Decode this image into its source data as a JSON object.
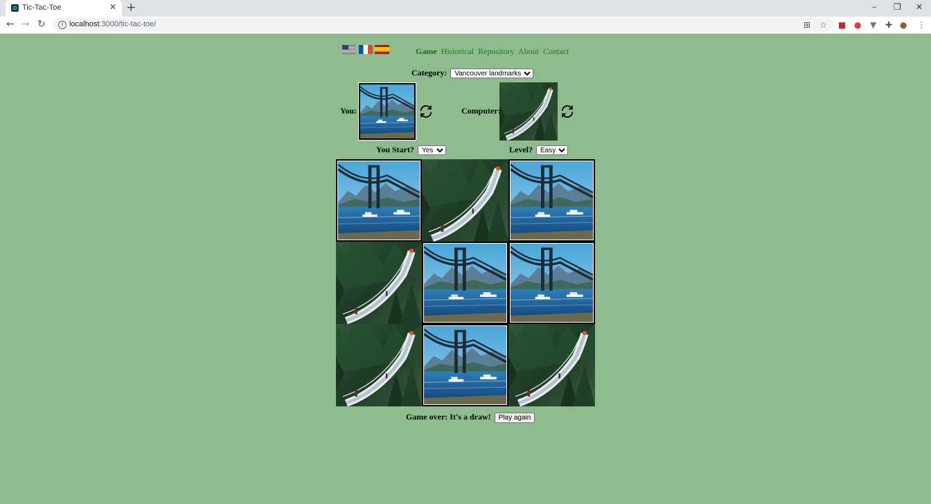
{
  "browser": {
    "tab_title": "Tic-Tac-Toe",
    "tab_close": "✕",
    "new_tab": "+",
    "window_controls": [
      "–",
      "❐",
      "✕"
    ],
    "url_host": "localhost",
    "url_rest": ":3000/tic-tac-toe/",
    "nav_icons": [
      "back-arrow-icon",
      "forward-arrow-icon",
      "reload-icon"
    ]
  },
  "languages": [
    "english-flag",
    "french-flag",
    "spanish-flag"
  ],
  "menu": {
    "items": [
      {
        "label": "Game",
        "active": true
      },
      {
        "label": "Historical",
        "active": false
      },
      {
        "label": "Repository",
        "active": false
      },
      {
        "label": "About",
        "active": false
      },
      {
        "label": "Contact",
        "active": false
      }
    ]
  },
  "category": {
    "label": "Category:",
    "selected": "Vancouver landmarks"
  },
  "players": {
    "you": {
      "label": "You:",
      "token": "lions-gate-bridge"
    },
    "computer": {
      "label": "Computer:",
      "token": "capilano-suspension-bridge"
    }
  },
  "options": {
    "you_start_label": "You Start?",
    "you_start_value": "Yes",
    "level_label": "Level?",
    "level_value": "Easy"
  },
  "board": [
    "lions-gate-bridge",
    "capilano-suspension-bridge",
    "lions-gate-bridge",
    "capilano-suspension-bridge",
    "lions-gate-bridge",
    "lions-gate-bridge",
    "capilano-suspension-bridge",
    "lions-gate-bridge",
    "capilano-suspension-bridge"
  ],
  "result": {
    "text": "Game over: It's a draw!",
    "button": "Play again"
  },
  "colors": {
    "page_background": "#8fbc8f",
    "link": "#1a7a1a"
  }
}
